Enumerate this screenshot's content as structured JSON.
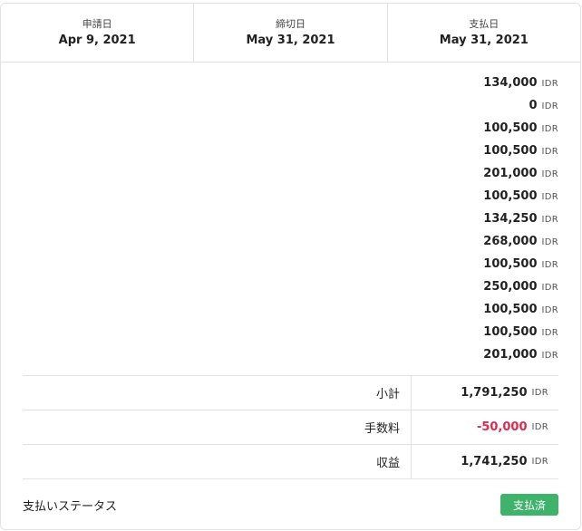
{
  "dates": [
    {
      "label": "申請日",
      "value": "Apr 9, 2021"
    },
    {
      "label": "締切日",
      "value": "May 31, 2021"
    },
    {
      "label": "支払日",
      "value": "May 31, 2021"
    }
  ],
  "currency": "IDR",
  "items": [
    "134,000",
    "0",
    "100,500",
    "100,500",
    "201,000",
    "100,500",
    "134,250",
    "268,000",
    "100,500",
    "250,000",
    "100,500",
    "100,500",
    "201,000"
  ],
  "summary": {
    "subtotal_label": "小計",
    "subtotal_value": "1,791,250",
    "fee_label": "手数料",
    "fee_value": "-50,000",
    "net_label": "収益",
    "net_value": "1,741,250"
  },
  "status": {
    "label": "支払いステータス",
    "badge": "支払済",
    "badge_color": "#3fb36b"
  },
  "colors": {
    "negative": "#e0294d",
    "border": "#e3e3e3"
  }
}
